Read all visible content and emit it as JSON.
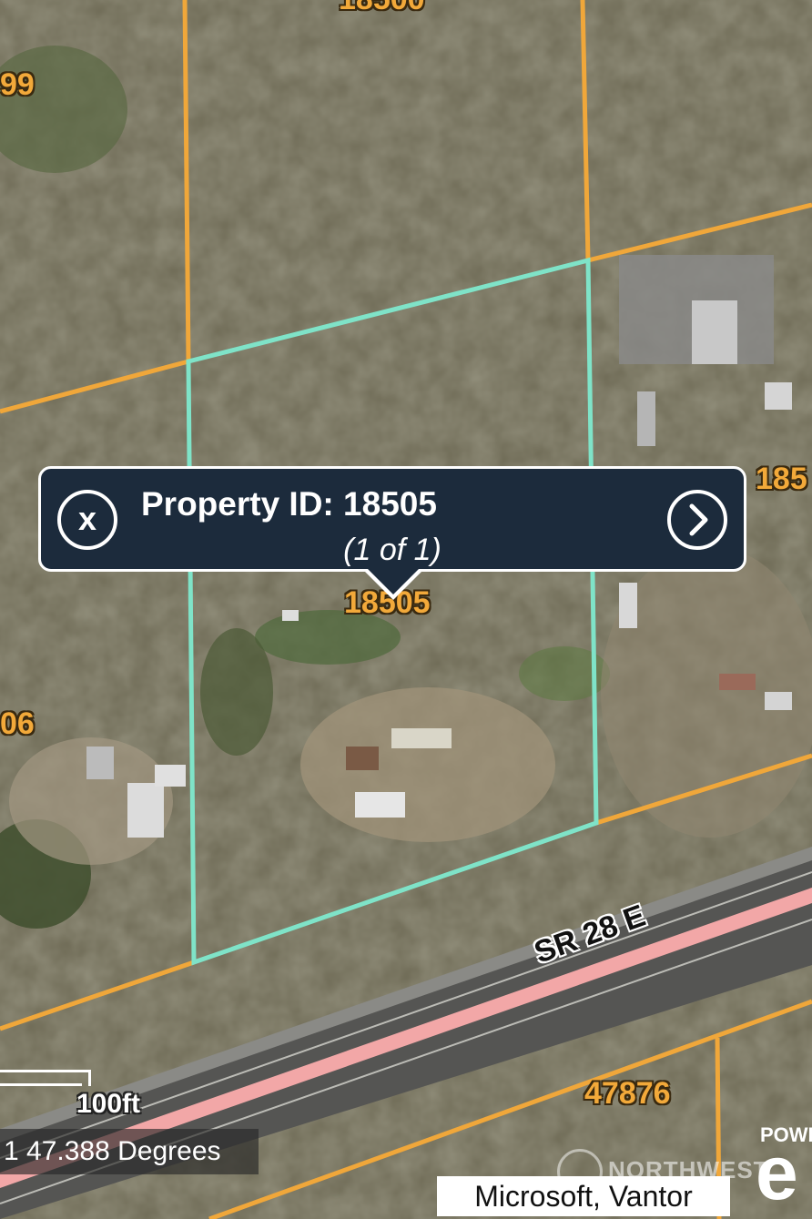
{
  "popup": {
    "title": "Property ID: 18505",
    "subtitle": "(1 of 1)",
    "close_icon": "x-circle-icon",
    "next_icon": "chevron-right-circle-icon"
  },
  "parcel_labels": {
    "top": "18500",
    "left_upper": "99",
    "right_mid": "185",
    "center": "18505",
    "left_mid": "06",
    "bottom": "47876"
  },
  "road_label": "SR 28 E",
  "scale": {
    "label": "100ft"
  },
  "bearing": "1 47.388 Degrees",
  "attribution": "Microsoft, Vantor",
  "watermark": "NORTHWEST",
  "powered_by": "POWE",
  "colors": {
    "parcel_line": "#f0a73a",
    "selected_parcel": "#7fe3c8",
    "highway_band": "#f2a7a7",
    "popup_bg": "#1c2b3c"
  }
}
